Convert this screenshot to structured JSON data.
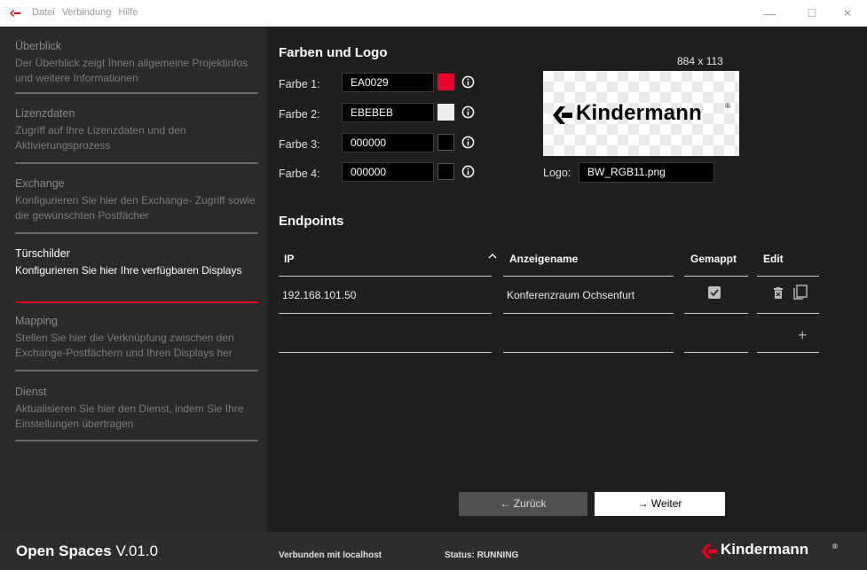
{
  "menu": {
    "items": [
      "Datei",
      "Verbindung",
      "Hilfe"
    ]
  },
  "window": {
    "minimize": "—",
    "maximize": "☐",
    "close": "✕"
  },
  "sidebar": {
    "items": [
      {
        "title": "Überblick",
        "desc": "Der Überblick zeigt Ihnen allgemeine Projektinfos und weitere Informationen"
      },
      {
        "title": "Lizenzdaten",
        "desc": "Zugriff auf Ihre Lizenzdaten und den Aktivierungsprozess"
      },
      {
        "title": "Exchange",
        "desc": "Konfigurieren Sie hier den Exchange- Zugriff sowie die gewünschten Postfächer"
      },
      {
        "title": "Türschilder",
        "desc": "Konfigurieren Sie hier Ihre verfügbaren Displays"
      },
      {
        "title": "Mapping",
        "desc": "Stellen Sie hier die Verknüpfung zwischen den Exchange-Postfächern und Ihren Displays her"
      },
      {
        "title": "Dienst",
        "desc": "Aktualisieren Sie hier den Dienst, indem Sie Ihre Einstellungen übertragen"
      }
    ],
    "active_index": 3
  },
  "colors_section": {
    "title": "Farben und Logo",
    "fields": [
      {
        "label": "Farbe 1:",
        "value": "EA0029",
        "swatch": "#EA0029"
      },
      {
        "label": "Farbe 2:",
        "value": "EBEBEB",
        "swatch": "#EBEBEB"
      },
      {
        "label": "Farbe 3:",
        "value": "000000",
        "swatch": "#000000"
      },
      {
        "label": "Farbe 4:",
        "value": "000000",
        "swatch": "#000000"
      }
    ],
    "logo_dims": "884 x 113",
    "logo_preview_text": "Kindermann",
    "logo_reg": "®",
    "logo_label": "Logo:",
    "logo_file": "BW_RGB11.png"
  },
  "endpoints": {
    "title": "Endpoints",
    "headers": {
      "ip": "IP",
      "name": "Anzeigename",
      "mapped": "Gemappt",
      "edit": "Edit"
    },
    "rows": [
      {
        "ip": "192.168.101.50",
        "name": "Konferenzraum Ochsenfurt",
        "mapped": true
      }
    ],
    "add_symbol": "+"
  },
  "buttons": {
    "back": "← Zurück",
    "next": "→ Weiter"
  },
  "footer": {
    "app_name": "Open Spaces",
    "version": "V.01.0",
    "connection": "Verbunden mit localhost",
    "status": "Status: RUNNING",
    "brand": "Kindermann",
    "brand_reg": "®"
  },
  "colors": {
    "accent": "#E3001B",
    "sidebar_bg": "#2A2A2A",
    "main_bg": "#1F1F1F"
  }
}
